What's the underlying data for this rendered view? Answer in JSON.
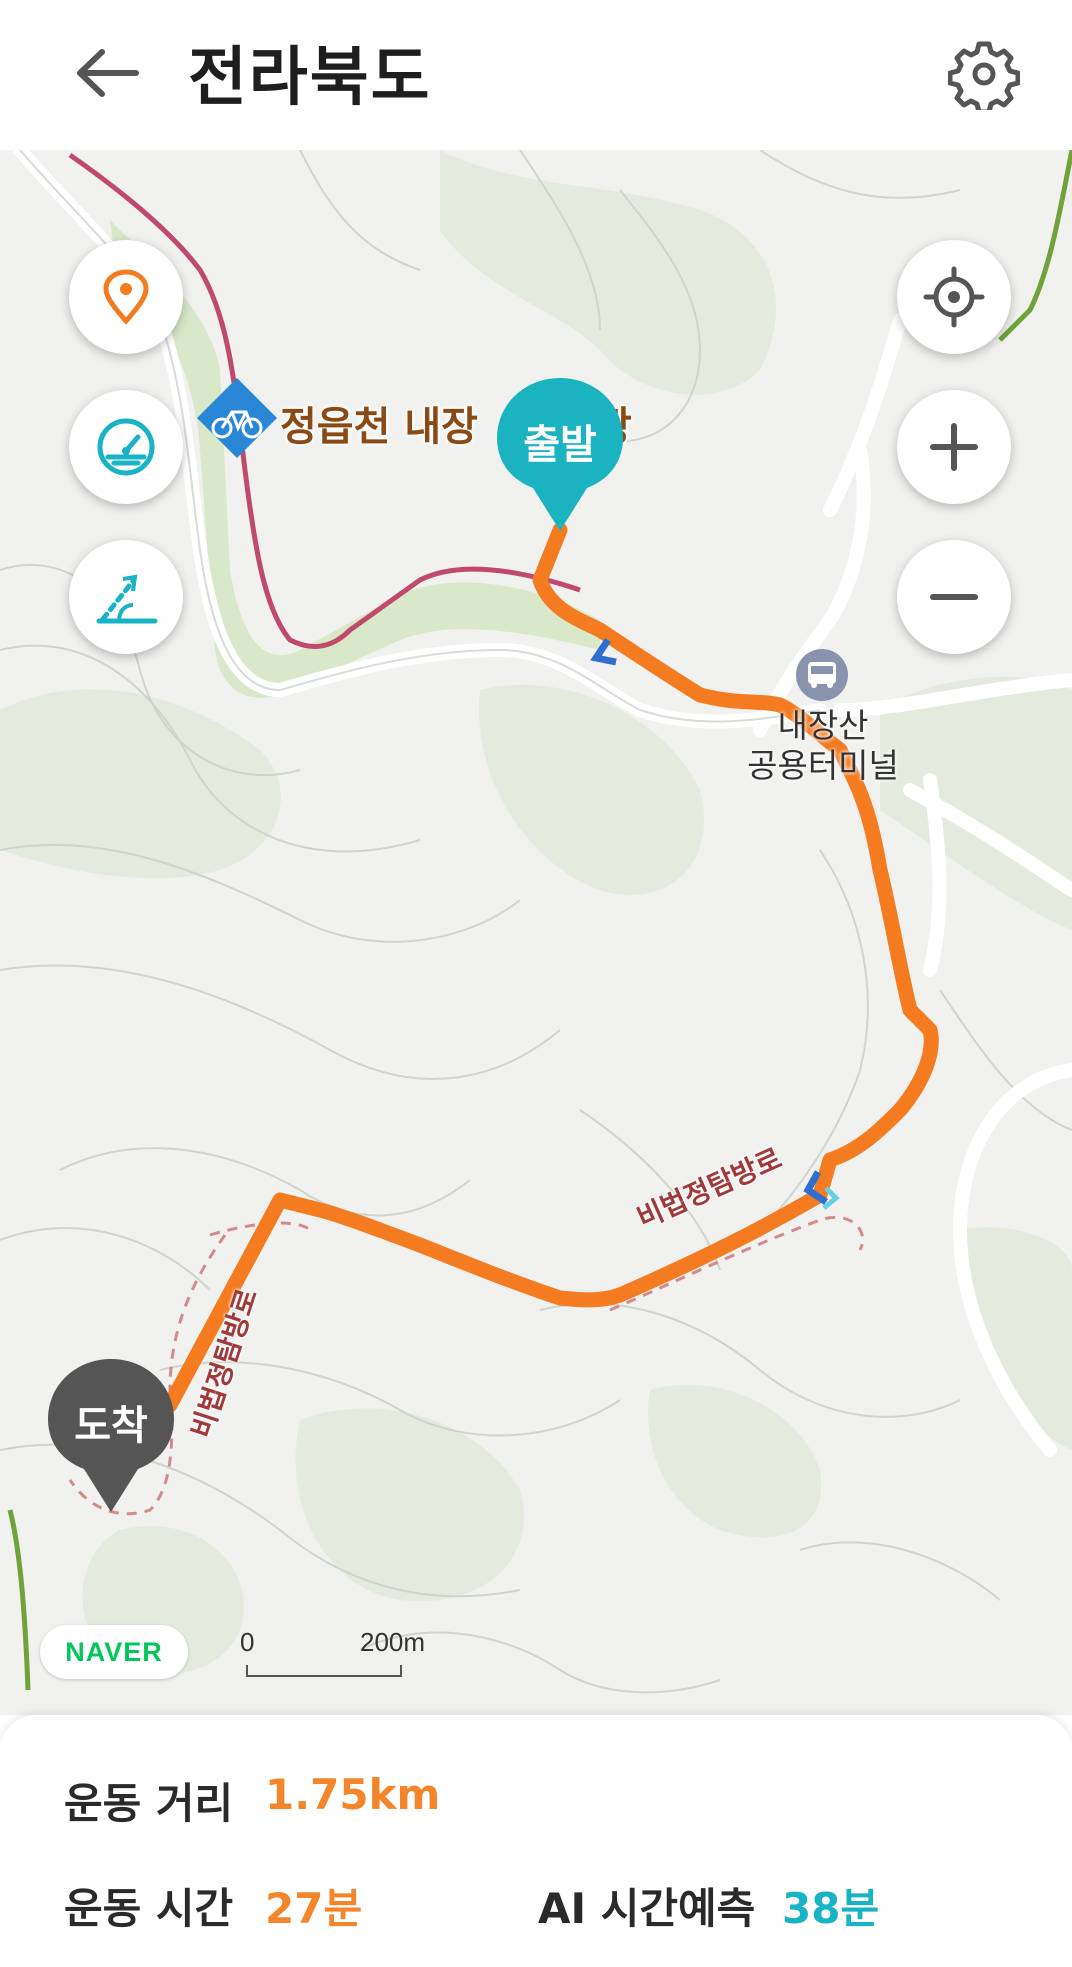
{
  "header": {
    "title": "전라북도",
    "back_icon": "arrow-left-icon",
    "settings_icon": "gear-icon"
  },
  "map": {
    "start_pin_label": "출발",
    "end_pin_label": "도착",
    "bike_place_label": "정읍천 내장",
    "bike_place_label_suffix": "장",
    "terminal_label_line1": "내장산",
    "terminal_label_line2": "공용터미널",
    "trail_label_1": "비법정탐방로",
    "trail_label_2": "비법정탐방로",
    "brand_badge": "NAVER",
    "scale_start": "0",
    "scale_end": "200m",
    "colors": {
      "route": "#f47b20",
      "start_pin": "#1bb3c0",
      "end_pin": "#555555",
      "bike_path": "#c04a6e",
      "green_area": "#d9e8c9"
    },
    "left_controls": [
      "location-pin-icon",
      "speedometer-icon",
      "slope-icon"
    ],
    "right_controls": [
      "crosshair-icon",
      "plus-icon",
      "minus-icon"
    ]
  },
  "stats": {
    "distance_label": "운동 거리",
    "distance_value": "1.75km",
    "time_label": "운동 시간",
    "time_value": "27분",
    "ai_label": "AI 시간예측",
    "ai_value": "38분"
  }
}
